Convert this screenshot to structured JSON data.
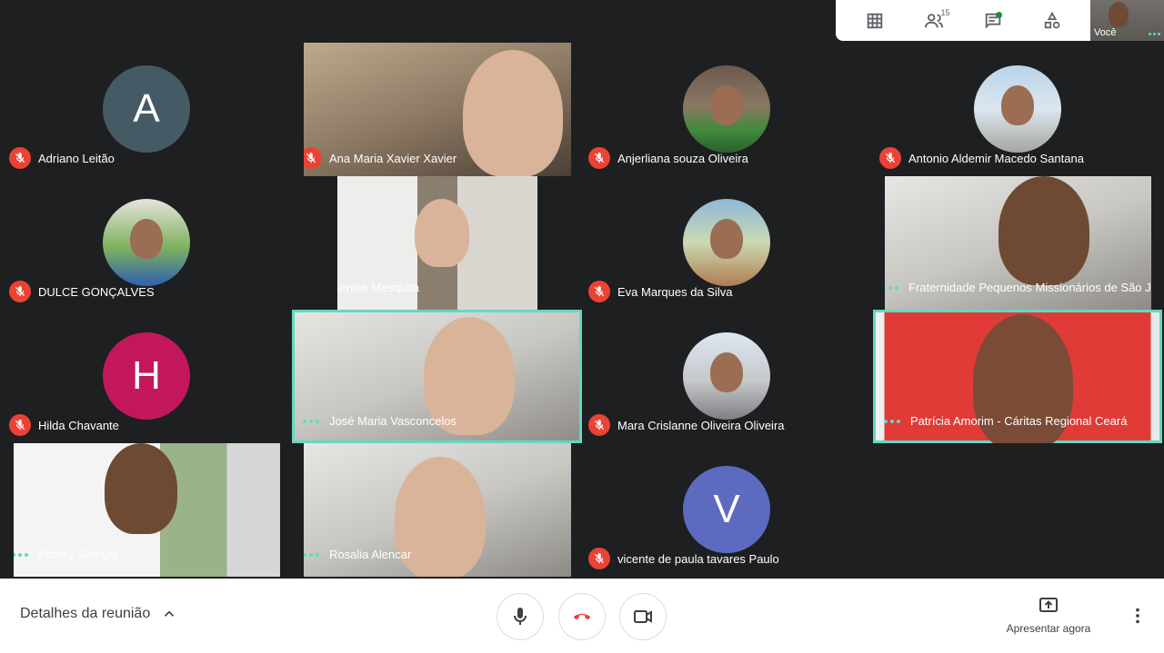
{
  "top_bar": {
    "participants_count": "15",
    "self_label": "Você"
  },
  "participants": [
    {
      "name": "Adriano Leitão",
      "initial": "A",
      "color": "#455a64",
      "muted": true
    },
    {
      "name": "Ana Maria Xavier Xavier",
      "muted": true
    },
    {
      "name": "Anjerliana souza Oliveira",
      "muted": true
    },
    {
      "name": "Antonio Aldemir Macedo Santana",
      "muted": true
    },
    {
      "name": "DULCE GONÇALVES",
      "muted": true
    },
    {
      "name": "Elenise Mesquita",
      "muted": false
    },
    {
      "name": "Eva Marques da Silva",
      "muted": true
    },
    {
      "name": "Fraternidade Pequenos Missionários de São J...",
      "muted": false
    },
    {
      "name": "Hilda Chavante",
      "initial": "H",
      "color": "#c2185b",
      "muted": true
    },
    {
      "name": "José Maria Vasconcelos",
      "muted": false,
      "speaking": true
    },
    {
      "name": "Mara Crislanne Oliveira Oliveira",
      "muted": true
    },
    {
      "name": "Patrícia Amorim - Cáritas Regional Ceará",
      "muted": false,
      "speaking": true
    },
    {
      "name": "Patriky Samuel",
      "muted": false
    },
    {
      "name": "Rosalia Alencar",
      "muted": false
    },
    {
      "name": "vicente de paula tavares Paulo",
      "initial": "V",
      "color": "#5c6bc0",
      "muted": true
    }
  ],
  "bottom_bar": {
    "details_label": "Detalhes da reunião",
    "present_label": "Apresentar agora"
  },
  "colors": {
    "mute_red": "#ea4335",
    "active_speaker": "#64d8c1",
    "hangup_red": "#ea4335"
  }
}
